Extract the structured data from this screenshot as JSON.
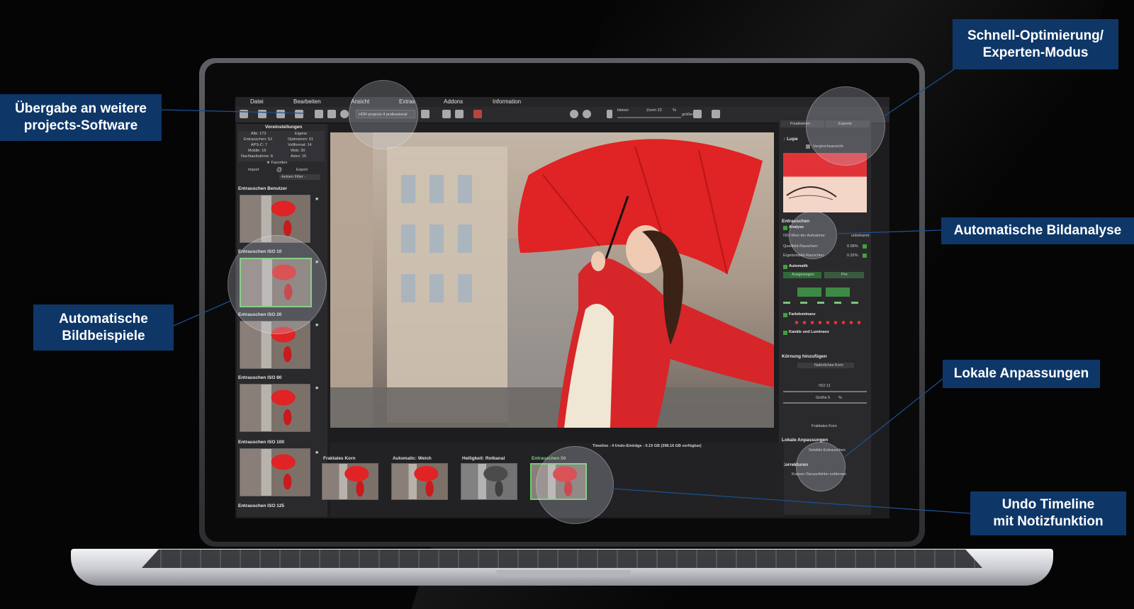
{
  "menu": [
    "Datei",
    "Bearbeiten",
    "Ansicht",
    "Extras",
    "Addons",
    "Information"
  ],
  "toolbar": {
    "preset_combo": "HDR projects 4 professional",
    "zoom_label": "Zoom 23",
    "zoom_unit": "%",
    "small_label": "kleiner",
    "large_label": "größer"
  },
  "left_panel": {
    "title": "Voreinstellungen",
    "stats": [
      [
        "Alle: 173",
        "Eigene"
      ],
      [
        "Entrauschen: 52",
        "Optimieren: 51"
      ],
      [
        "APS-C: 7",
        "Vollformat: 14"
      ],
      [
        "Mobile: 16",
        "Web: 30"
      ],
      [
        "Nachtaufnahme: 8",
        "Astro: 15"
      ]
    ],
    "favorites": "Favoriten",
    "import": "Import",
    "export": "Export",
    "filter": "-keinen Filter -",
    "presets": [
      "Entrauschen Benutzer",
      "Entrauschen ISO 10",
      "Entrauschen ISO 20",
      "Entrauschen ISO 80",
      "Entrauschen ISO 100",
      "Entrauschen ISO 125"
    ]
  },
  "right_panel": {
    "tab_finalize": "Finalisieren",
    "tab_expert": "Experte",
    "lupe": "Lupe",
    "compare": "Vergleichsansicht",
    "denoise": "Entrauschen",
    "analysis": "Analyse",
    "iso_label": "ISO-Wert der Aufnahme:",
    "iso_value": "unbekannt",
    "source_noise_label": "Quellbild-Rauschen:",
    "source_noise_value": "0.58%",
    "result_noise_label": "Ergebnisbild-Rauschen:",
    "result_noise_value": "0.32%",
    "auto": "Automatik",
    "balanced": "Ausgewogen",
    "pro": "Pro",
    "color_dominance": "Farbdominanz",
    "channels": "Kanäle und Luminanz",
    "grain": "Körnung hinzufügen",
    "grain_type": "Natürliches Korn",
    "iso": "ISO 11",
    "size": "Größe 5",
    "size_unit": "%",
    "fractal": "Fraktales Korn",
    "local": "Lokale Anpassungen",
    "selective": "Selektiv Entrauschen",
    "corrections": "Korrekturen",
    "sensor": "Kratzer-/Sensorfehler entfernen"
  },
  "timeline": {
    "header": "Timeline - 4 Undo-Einträge - 0.19 GB (398.16 GB verfügbar)",
    "items": [
      "Fraktales Korn",
      "Automatic: Weich",
      "Helligkeit: Rotkanal",
      "Entrauschen 50"
    ]
  },
  "callouts": {
    "uebergabe": [
      "Übergabe an weitere",
      "projects-Software"
    ],
    "schnell": [
      "Schnell-Optimierung/",
      "Experten-Modus"
    ],
    "bildanalyse": "Automatische Bildanalyse",
    "bildbeispiele": [
      "Automatische",
      "Bildbeispiele"
    ],
    "lokale": "Lokale Anpassungen",
    "undo": [
      "Undo Timeline",
      "mit Notizfunktion"
    ]
  },
  "colors": {
    "callout_bg": "#0e3768",
    "accent_green": "#3fa13f",
    "umbrella_red": "#e02324"
  }
}
